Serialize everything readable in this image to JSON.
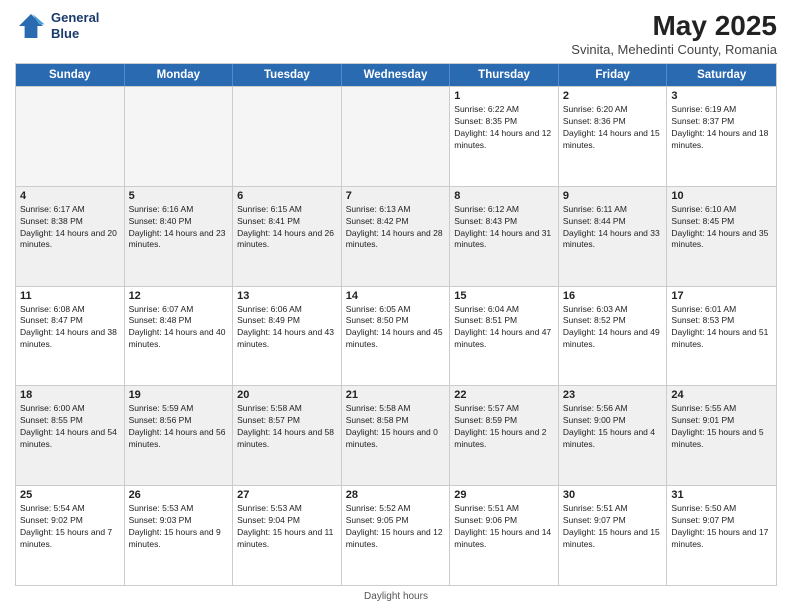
{
  "header": {
    "logo_line1": "General",
    "logo_line2": "Blue",
    "title": "May 2025",
    "subtitle": "Svinita, Mehedinti County, Romania"
  },
  "days_of_week": [
    "Sunday",
    "Monday",
    "Tuesday",
    "Wednesday",
    "Thursday",
    "Friday",
    "Saturday"
  ],
  "weeks": [
    [
      {
        "day": "",
        "text": "",
        "empty": true
      },
      {
        "day": "",
        "text": "",
        "empty": true
      },
      {
        "day": "",
        "text": "",
        "empty": true
      },
      {
        "day": "",
        "text": "",
        "empty": true
      },
      {
        "day": "1",
        "text": "Sunrise: 6:22 AM\nSunset: 8:35 PM\nDaylight: 14 hours and 12 minutes.",
        "empty": false
      },
      {
        "day": "2",
        "text": "Sunrise: 6:20 AM\nSunset: 8:36 PM\nDaylight: 14 hours and 15 minutes.",
        "empty": false
      },
      {
        "day": "3",
        "text": "Sunrise: 6:19 AM\nSunset: 8:37 PM\nDaylight: 14 hours and 18 minutes.",
        "empty": false
      }
    ],
    [
      {
        "day": "4",
        "text": "Sunrise: 6:17 AM\nSunset: 8:38 PM\nDaylight: 14 hours and 20 minutes.",
        "empty": false
      },
      {
        "day": "5",
        "text": "Sunrise: 6:16 AM\nSunset: 8:40 PM\nDaylight: 14 hours and 23 minutes.",
        "empty": false
      },
      {
        "day": "6",
        "text": "Sunrise: 6:15 AM\nSunset: 8:41 PM\nDaylight: 14 hours and 26 minutes.",
        "empty": false
      },
      {
        "day": "7",
        "text": "Sunrise: 6:13 AM\nSunset: 8:42 PM\nDaylight: 14 hours and 28 minutes.",
        "empty": false
      },
      {
        "day": "8",
        "text": "Sunrise: 6:12 AM\nSunset: 8:43 PM\nDaylight: 14 hours and 31 minutes.",
        "empty": false
      },
      {
        "day": "9",
        "text": "Sunrise: 6:11 AM\nSunset: 8:44 PM\nDaylight: 14 hours and 33 minutes.",
        "empty": false
      },
      {
        "day": "10",
        "text": "Sunrise: 6:10 AM\nSunset: 8:45 PM\nDaylight: 14 hours and 35 minutes.",
        "empty": false
      }
    ],
    [
      {
        "day": "11",
        "text": "Sunrise: 6:08 AM\nSunset: 8:47 PM\nDaylight: 14 hours and 38 minutes.",
        "empty": false
      },
      {
        "day": "12",
        "text": "Sunrise: 6:07 AM\nSunset: 8:48 PM\nDaylight: 14 hours and 40 minutes.",
        "empty": false
      },
      {
        "day": "13",
        "text": "Sunrise: 6:06 AM\nSunset: 8:49 PM\nDaylight: 14 hours and 43 minutes.",
        "empty": false
      },
      {
        "day": "14",
        "text": "Sunrise: 6:05 AM\nSunset: 8:50 PM\nDaylight: 14 hours and 45 minutes.",
        "empty": false
      },
      {
        "day": "15",
        "text": "Sunrise: 6:04 AM\nSunset: 8:51 PM\nDaylight: 14 hours and 47 minutes.",
        "empty": false
      },
      {
        "day": "16",
        "text": "Sunrise: 6:03 AM\nSunset: 8:52 PM\nDaylight: 14 hours and 49 minutes.",
        "empty": false
      },
      {
        "day": "17",
        "text": "Sunrise: 6:01 AM\nSunset: 8:53 PM\nDaylight: 14 hours and 51 minutes.",
        "empty": false
      }
    ],
    [
      {
        "day": "18",
        "text": "Sunrise: 6:00 AM\nSunset: 8:55 PM\nDaylight: 14 hours and 54 minutes.",
        "empty": false
      },
      {
        "day": "19",
        "text": "Sunrise: 5:59 AM\nSunset: 8:56 PM\nDaylight: 14 hours and 56 minutes.",
        "empty": false
      },
      {
        "day": "20",
        "text": "Sunrise: 5:58 AM\nSunset: 8:57 PM\nDaylight: 14 hours and 58 minutes.",
        "empty": false
      },
      {
        "day": "21",
        "text": "Sunrise: 5:58 AM\nSunset: 8:58 PM\nDaylight: 15 hours and 0 minutes.",
        "empty": false
      },
      {
        "day": "22",
        "text": "Sunrise: 5:57 AM\nSunset: 8:59 PM\nDaylight: 15 hours and 2 minutes.",
        "empty": false
      },
      {
        "day": "23",
        "text": "Sunrise: 5:56 AM\nSunset: 9:00 PM\nDaylight: 15 hours and 4 minutes.",
        "empty": false
      },
      {
        "day": "24",
        "text": "Sunrise: 5:55 AM\nSunset: 9:01 PM\nDaylight: 15 hours and 5 minutes.",
        "empty": false
      }
    ],
    [
      {
        "day": "25",
        "text": "Sunrise: 5:54 AM\nSunset: 9:02 PM\nDaylight: 15 hours and 7 minutes.",
        "empty": false
      },
      {
        "day": "26",
        "text": "Sunrise: 5:53 AM\nSunset: 9:03 PM\nDaylight: 15 hours and 9 minutes.",
        "empty": false
      },
      {
        "day": "27",
        "text": "Sunrise: 5:53 AM\nSunset: 9:04 PM\nDaylight: 15 hours and 11 minutes.",
        "empty": false
      },
      {
        "day": "28",
        "text": "Sunrise: 5:52 AM\nSunset: 9:05 PM\nDaylight: 15 hours and 12 minutes.",
        "empty": false
      },
      {
        "day": "29",
        "text": "Sunrise: 5:51 AM\nSunset: 9:06 PM\nDaylight: 15 hours and 14 minutes.",
        "empty": false
      },
      {
        "day": "30",
        "text": "Sunrise: 5:51 AM\nSunset: 9:07 PM\nDaylight: 15 hours and 15 minutes.",
        "empty": false
      },
      {
        "day": "31",
        "text": "Sunrise: 5:50 AM\nSunset: 9:07 PM\nDaylight: 15 hours and 17 minutes.",
        "empty": false
      }
    ]
  ],
  "footer": "Daylight hours"
}
